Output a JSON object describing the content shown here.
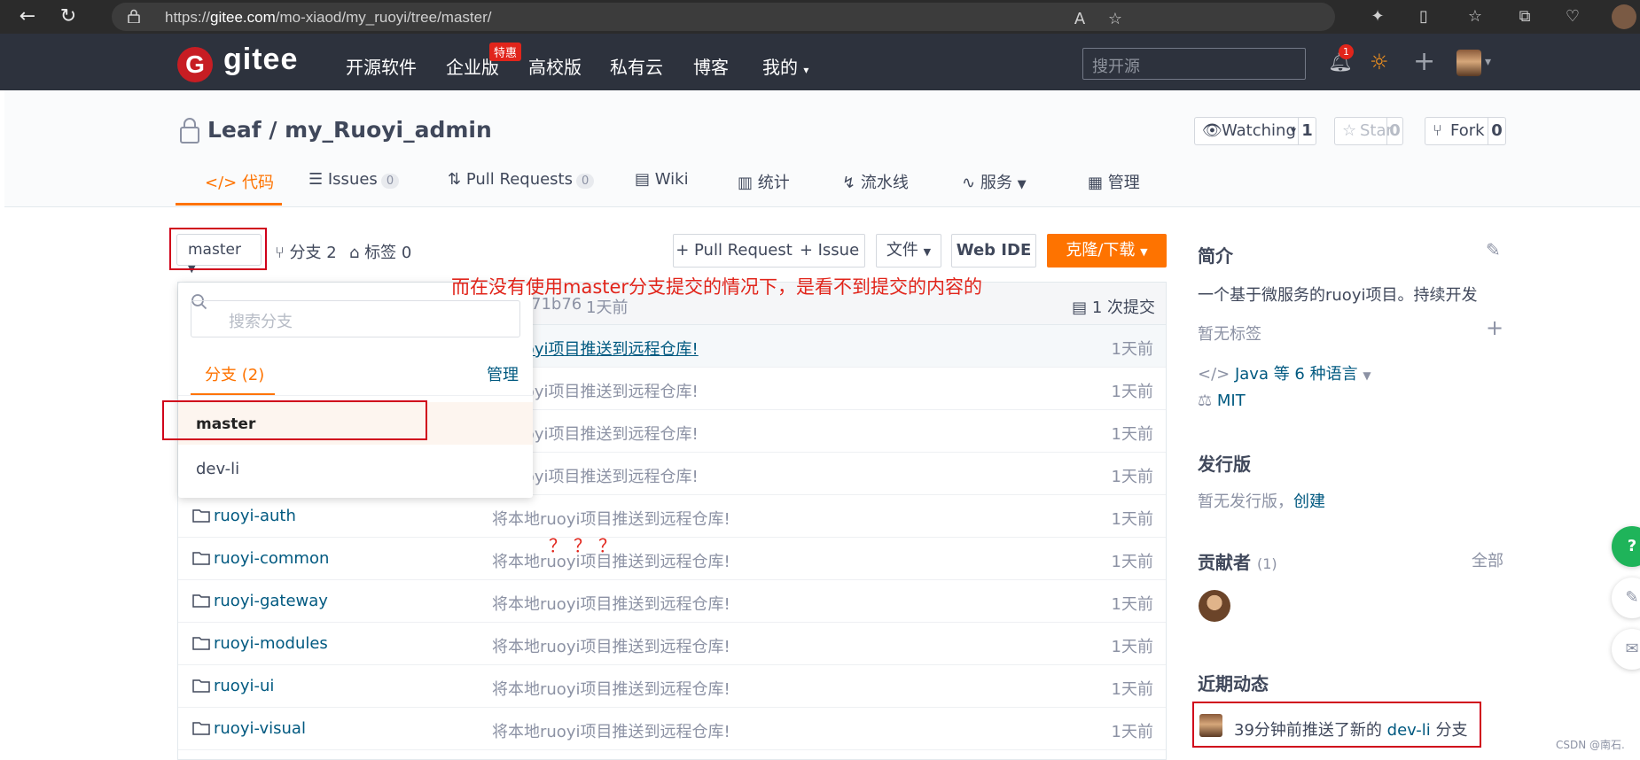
{
  "browser": {
    "url_prefix": "https://",
    "url_host": "gitee.com",
    "url_path": "/mo-xiaod/my_ruoyi/tree/master/"
  },
  "header": {
    "logo_mark": "G",
    "logo_text": "gitee",
    "nav": [
      "开源软件",
      "企业版",
      "高校版",
      "私有云",
      "博客",
      "我的"
    ],
    "special_badge": "特惠",
    "search_placeholder": "搜开源",
    "notification_count": "1"
  },
  "repo": {
    "title": "Leaf / my_Ruoyi_admin",
    "watch_label": "Watching",
    "watch_count": "1",
    "star_label": "Star",
    "star_count": "0",
    "fork_label": "Fork",
    "fork_count": "0"
  },
  "tabs": [
    {
      "label": "代码",
      "icon": "code-icon"
    },
    {
      "label": "Issues",
      "count": "0",
      "icon": "issues-icon"
    },
    {
      "label": "Pull Requests",
      "count": "0",
      "icon": "pull-request-icon"
    },
    {
      "label": "Wiki",
      "icon": "book-icon"
    },
    {
      "label": "统计",
      "icon": "chart-icon"
    },
    {
      "label": "流水线",
      "icon": "pipeline-icon"
    },
    {
      "label": "服务",
      "icon": "pulse-icon"
    },
    {
      "label": "管理",
      "icon": "manage-icon"
    }
  ],
  "toolbar": {
    "branch": "master",
    "branches_label": "分支 2",
    "tags_label": "标签 0",
    "pull_request": "+ Pull Request",
    "issue": "+ Issue",
    "file": "文件",
    "web_ide": "Web IDE",
    "clone": "克隆/下载"
  },
  "commit_bar": {
    "hash": "71b76",
    "time": "1天前",
    "commits": "1 次提交"
  },
  "files": [
    {
      "name": "",
      "msg": "地ruoyi项目推送到远程仓库!",
      "time": "1天前"
    },
    {
      "name": "",
      "msg": "地ruoyi项目推送到远程仓库!",
      "time": "1天前"
    },
    {
      "name": "",
      "msg": "地ruoyi项目推送到远程仓库!",
      "time": "1天前"
    },
    {
      "name": "",
      "msg": "地ruoyi项目推送到远程仓库!",
      "time": "1天前"
    },
    {
      "name": "ruoyi-auth",
      "msg": "将本地ruoyi项目推送到远程仓库!",
      "time": "1天前"
    },
    {
      "name": "ruoyi-common",
      "msg": "将本地ruoyi项目推送到远程仓库!",
      "time": "1天前"
    },
    {
      "name": "ruoyi-gateway",
      "msg": "将本地ruoyi项目推送到远程仓库!",
      "time": "1天前"
    },
    {
      "name": "ruoyi-modules",
      "msg": "将本地ruoyi项目推送到远程仓库!",
      "time": "1天前"
    },
    {
      "name": "ruoyi-ui",
      "msg": "将本地ruoyi项目推送到远程仓库!",
      "time": "1天前"
    },
    {
      "name": "ruoyi-visual",
      "msg": "将本地ruoyi项目推送到远程仓库!",
      "time": "1天前"
    }
  ],
  "dropdown": {
    "search_placeholder": "搜索分支",
    "tab": "分支 (2)",
    "manage": "管理",
    "branches": [
      "master",
      "dev-li"
    ]
  },
  "annotations": {
    "note": "而在没有使用master分支提交的情况下，是看不到提交的内容的",
    "question": "？？？"
  },
  "sidebar": {
    "intro_title": "简介",
    "intro_text": "一个基于微服务的ruoyi项目。持续开发",
    "no_tags": "暂无标签",
    "language": "Java 等 6 种语言",
    "license": "MIT",
    "releases_title": "发行版",
    "releases_text": "暂无发行版，",
    "releases_create": "创建",
    "contributors_title": "贡献者",
    "contributors_count": "(1)",
    "contributors_all": "全部",
    "activity_title": "近期动态",
    "activity_text": "39分钟前推送了新的",
    "activity_branch": "dev-li",
    "activity_suffix": "分支"
  },
  "watermark": "CSDN @南石.",
  "colors": {
    "accent": "#fe7300",
    "link": "#005980",
    "annotation": "#e1251b",
    "header_bg": "#2d323d"
  }
}
